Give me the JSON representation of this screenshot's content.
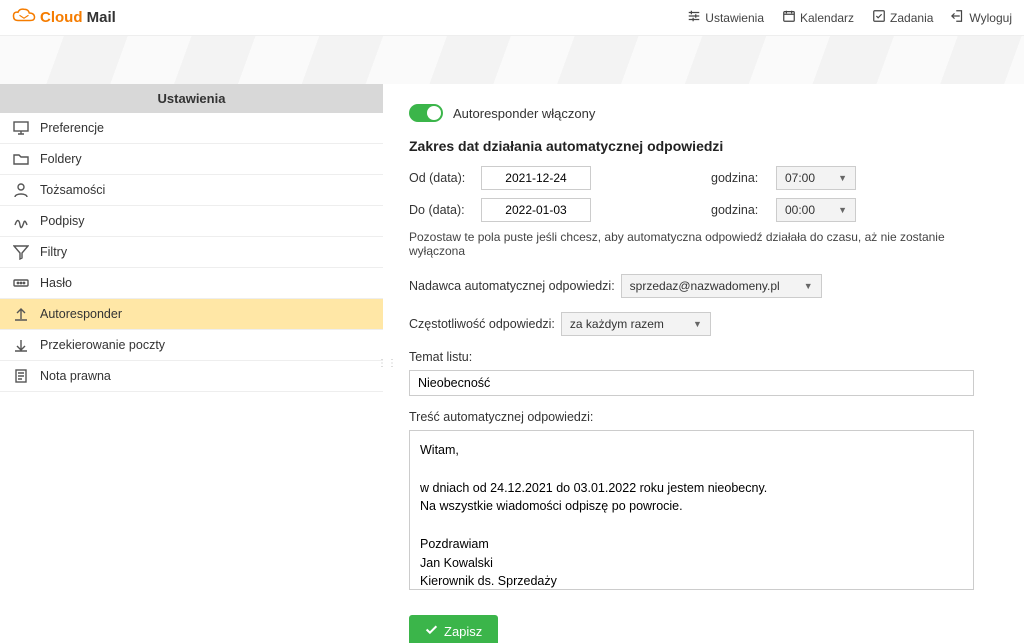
{
  "app": {
    "name_part1": "Cloud",
    "name_part2": "Mail"
  },
  "topnav": {
    "settings": "Ustawienia",
    "calendar": "Kalendarz",
    "tasks": "Zadania",
    "logout": "Wyloguj"
  },
  "sidebar": {
    "title": "Ustawienia",
    "items": [
      {
        "label": "Preferencje"
      },
      {
        "label": "Foldery"
      },
      {
        "label": "Tożsamości"
      },
      {
        "label": "Podpisy"
      },
      {
        "label": "Filtry"
      },
      {
        "label": "Hasło"
      },
      {
        "label": "Autoresponder"
      },
      {
        "label": "Przekierowanie poczty"
      },
      {
        "label": "Nota prawna"
      }
    ]
  },
  "form": {
    "toggle_label": "Autoresponder włączony",
    "section_title": "Zakres dat działania automatycznej odpowiedzi",
    "from_label": "Od (data):",
    "to_label": "Do (data):",
    "time_label": "godzina:",
    "from_date": "2021-12-24",
    "to_date": "2022-01-03",
    "from_time": "07:00",
    "to_time": "00:00",
    "hint": "Pozostaw te pola puste jeśli chcesz, aby automatyczna odpowiedź działała do czasu, aż nie zostanie wyłączona",
    "sender_label": "Nadawca automatycznej odpowiedzi:",
    "sender_value": "sprzedaz@nazwadomeny.pl",
    "freq_label": "Częstotliwość odpowiedzi:",
    "freq_value": "za każdym razem",
    "subject_label": "Temat listu:",
    "subject_value": "Nieobecność",
    "body_label": "Treść automatycznej odpowiedzi:",
    "body_value": "Witam,\n\nw dniach od 24.12.2021 do 03.01.2022 roku jestem nieobecny.\nNa wszystkie wiadomości odpiszę po powrocie.\n\nPozdrawiam\nJan Kowalski\nKierownik ds. Sprzedaży",
    "save_label": "Zapisz"
  }
}
